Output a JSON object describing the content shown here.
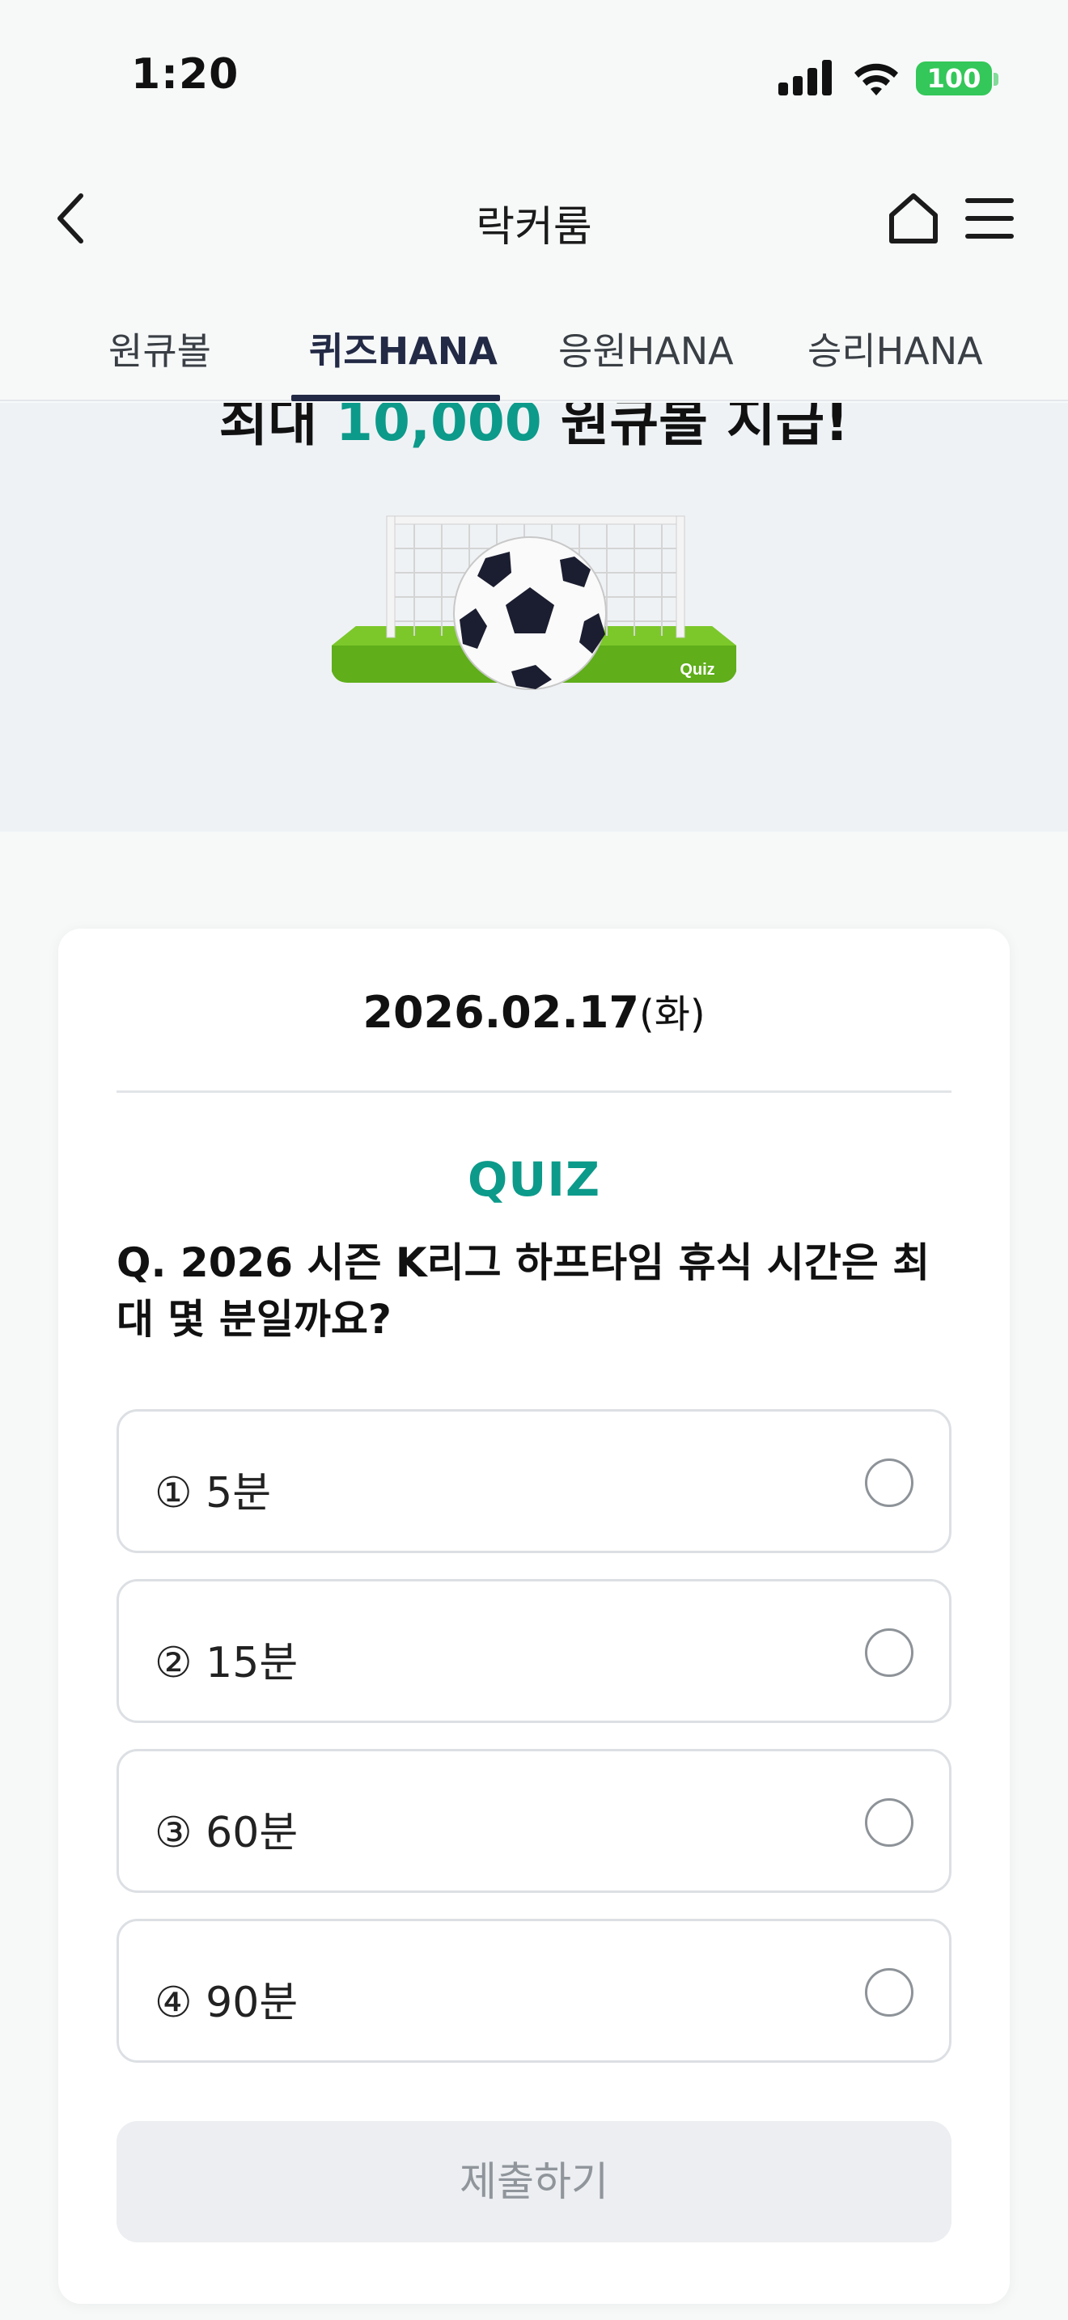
{
  "status_bar": {
    "time": "1:20",
    "battery": "100"
  },
  "nav": {
    "title": "락커룸"
  },
  "tabs": [
    {
      "label": "원큐볼",
      "active": false
    },
    {
      "label": "퀴즈HANA",
      "active": true
    },
    {
      "label": "응원HANA",
      "active": false
    },
    {
      "label": "승리HANA",
      "active": false
    }
  ],
  "banner": {
    "headline_prefix": "최대 ",
    "headline_amount": "10,000",
    "headline_suffix": " 원큐볼 지급!",
    "art_label": "Quiz"
  },
  "quiz": {
    "date": "2026.02.17",
    "day_of_week": "(화)",
    "label": "QUIZ",
    "question": "Q. 2026 시즌 K리그 하프타임 휴식 시간은 최대 몇 분일까요?",
    "options": [
      {
        "label": "① 5분"
      },
      {
        "label": "② 15분"
      },
      {
        "label": "③ 60분"
      },
      {
        "label": "④ 90분"
      }
    ],
    "submit_label": "제출하기"
  },
  "colors": {
    "accent": "#0c9a8a",
    "tab_active": "#232a45",
    "battery": "#34c759"
  }
}
